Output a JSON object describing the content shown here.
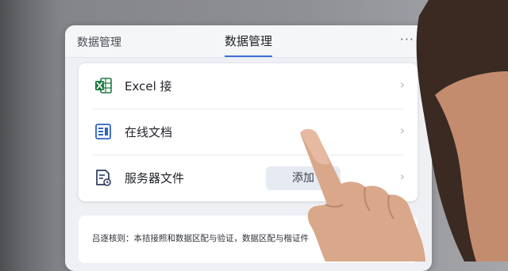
{
  "header": {
    "back_title": "数据管理",
    "center_title": "数据管理",
    "more_icon": "more-dots-icon",
    "more_glyph": "···"
  },
  "menu": {
    "items": [
      {
        "label": "Excel 接",
        "icon": "excel-icon"
      },
      {
        "label": "在线文档",
        "icon": "online-document-icon"
      },
      {
        "label": "服务器文件",
        "icon": "server-file-icon",
        "button_label": "添加"
      }
    ],
    "chevron_glyph": "›"
  },
  "note": {
    "text": "吕逐核则：本拮接照和数据区配与验证，数据区配与楷证件"
  },
  "colors": {
    "accent": "#3b6fd8",
    "excel_green": "#1f7a45",
    "doc_blue": "#2f63c6"
  }
}
